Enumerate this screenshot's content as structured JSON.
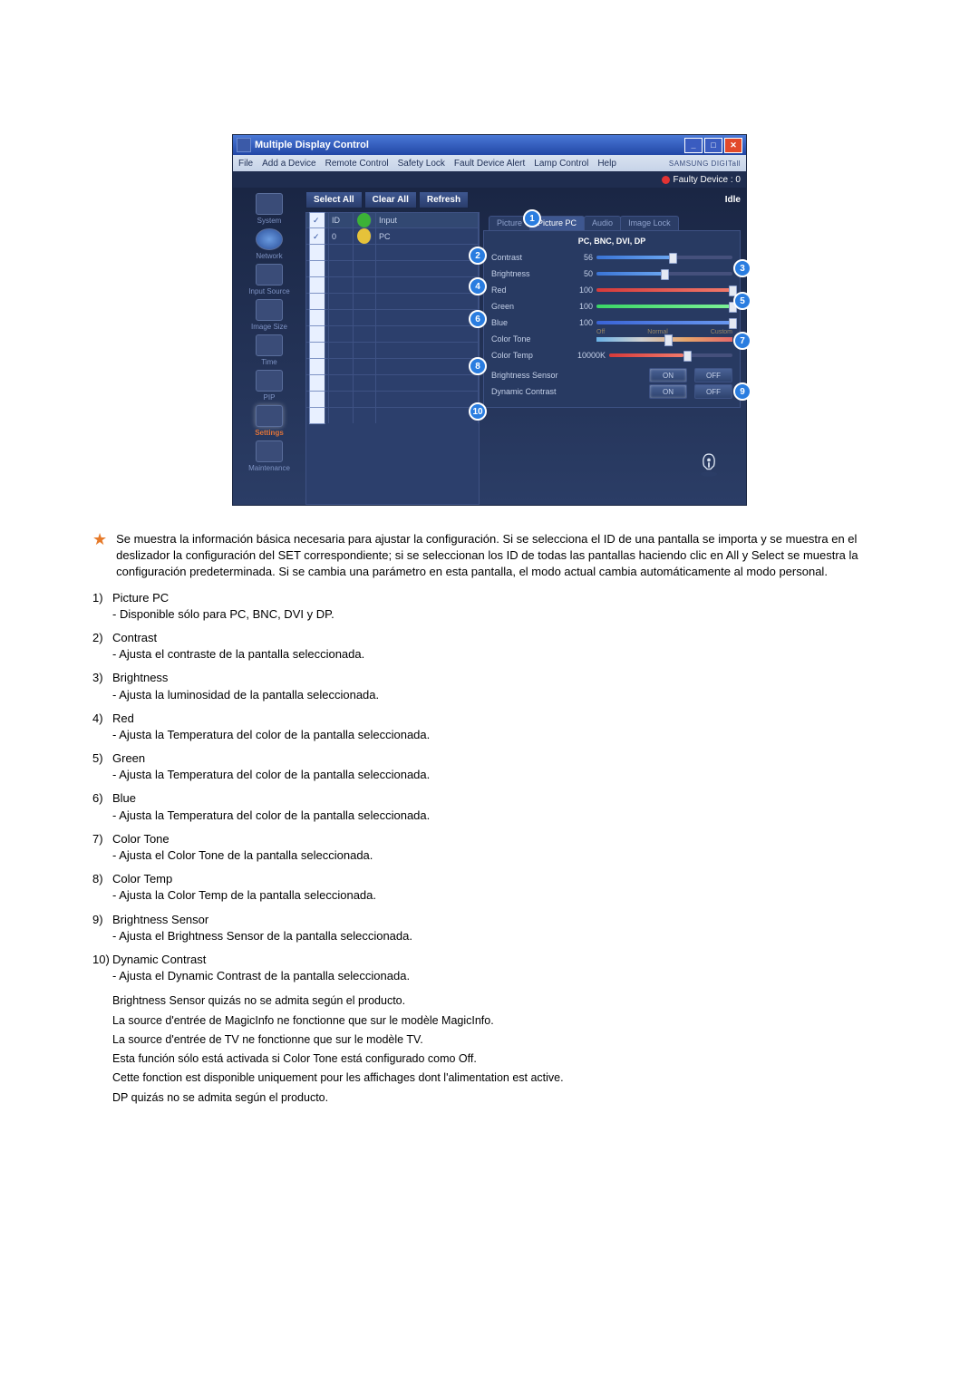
{
  "app": {
    "title": "Multiple Display Control",
    "menu": [
      "File",
      "Add a Device",
      "Remote Control",
      "Safety Lock",
      "Fault Device Alert",
      "Lamp Control",
      "Help"
    ],
    "brand": "SAMSUNG DIGITall",
    "faulty_label": "Faulty Device : 0",
    "idle": "Idle",
    "toolbar": {
      "select_all": "Select All",
      "clear_all": "Clear All",
      "refresh": "Refresh"
    },
    "sidebar": [
      {
        "label": "System"
      },
      {
        "label": "Network"
      },
      {
        "label": "Input Source"
      },
      {
        "label": "Image Size"
      },
      {
        "label": "Time"
      },
      {
        "label": "PIP"
      },
      {
        "label": "Settings",
        "selected": true
      },
      {
        "label": "Maintenance"
      }
    ],
    "grid": {
      "headers": {
        "id": "ID",
        "input": "Input"
      },
      "rows": [
        {
          "checked": true,
          "id": "0",
          "status": "y",
          "input": "PC"
        },
        {
          "checked": false,
          "id": "",
          "status": "",
          "input": ""
        },
        {
          "checked": false,
          "id": "",
          "status": "",
          "input": ""
        },
        {
          "checked": false,
          "id": "",
          "status": "",
          "input": ""
        },
        {
          "checked": false,
          "id": "",
          "status": "",
          "input": ""
        },
        {
          "checked": false,
          "id": "",
          "status": "",
          "input": ""
        },
        {
          "checked": false,
          "id": "",
          "status": "",
          "input": ""
        },
        {
          "checked": false,
          "id": "",
          "status": "",
          "input": ""
        },
        {
          "checked": false,
          "id": "",
          "status": "",
          "input": ""
        },
        {
          "checked": false,
          "id": "",
          "status": "",
          "input": ""
        },
        {
          "checked": false,
          "id": "",
          "status": "",
          "input": ""
        },
        {
          "checked": false,
          "id": "",
          "status": "",
          "input": ""
        }
      ]
    },
    "tabs": [
      "Picture",
      "Picture PC",
      "Audio",
      "Image Lock"
    ],
    "panel_title": "PC, BNC, DVI, DP",
    "sliders": {
      "contrast": {
        "label": "Contrast",
        "value": "56",
        "pct": 56,
        "fill": "c"
      },
      "brightness": {
        "label": "Brightness",
        "value": "50",
        "pct": 50,
        "fill": "c"
      },
      "red": {
        "label": "Red",
        "value": "100",
        "pct": 100,
        "fill": "r"
      },
      "green": {
        "label": "Green",
        "value": "100",
        "pct": 100,
        "fill": "g"
      },
      "blue": {
        "label": "Blue",
        "value": "100",
        "pct": 100,
        "fill": "b"
      }
    },
    "color_tone": {
      "label": "Color Tone",
      "labels": [
        "Off",
        "Normal",
        "Custom"
      ],
      "pos": 50
    },
    "color_temp": {
      "label": "Color Temp",
      "value": "10000K",
      "pos": 60
    },
    "brightness_sensor": {
      "label": "Brightness Sensor",
      "on": "ON",
      "off": "OFF"
    },
    "dynamic_contrast": {
      "label": "Dynamic Contrast",
      "on": "ON",
      "off": "OFF"
    }
  },
  "doc": {
    "intro": "Se muestra la información básica necesaria para ajustar la configuración. Si se selecciona el ID de una pantalla se importa y se muestra en el deslizador la configuración del SET correspondiente; si se seleccionan los ID de todas las pantallas haciendo clic en All y Select se muestra la configuración predeterminada. Si se cambia una parámetro en esta pantalla, el modo actual cambia automáticamente al modo personal.",
    "items": [
      {
        "n": "1)",
        "t": "Picture PC",
        "d": "- Disponible sólo para PC, BNC, DVI y DP."
      },
      {
        "n": "2)",
        "t": "Contrast",
        "d": "- Ajusta el contraste de la pantalla seleccionada."
      },
      {
        "n": "3)",
        "t": "Brightness",
        "d": "- Ajusta la luminosidad de la pantalla seleccionada."
      },
      {
        "n": "4)",
        "t": "Red",
        "d": "- Ajusta la Temperatura del color de la pantalla seleccionada."
      },
      {
        "n": "5)",
        "t": "Green",
        "d": "- Ajusta la Temperatura del color de la pantalla seleccionada."
      },
      {
        "n": "6)",
        "t": "Blue",
        "d": "- Ajusta la Temperatura del color de la pantalla seleccionada."
      },
      {
        "n": "7)",
        "t": "Color Tone",
        "d": "- Ajusta el Color Tone de la pantalla seleccionada."
      },
      {
        "n": "8)",
        "t": "Color Temp",
        "d": "- Ajusta la Color Temp de la pantalla seleccionada."
      },
      {
        "n": "9)",
        "t": "Brightness Sensor",
        "d": "- Ajusta el Brightness Sensor de la pantalla seleccionada."
      },
      {
        "n": "10)",
        "t": "Dynamic Contrast",
        "d": "- Ajusta el Dynamic Contrast de la pantalla seleccionada."
      }
    ],
    "notes": [
      "Brightness Sensor quizás no se admita según el producto.",
      "La source d'entrée de MagicInfo ne fonctionne que sur le modèle MagicInfo.",
      "La source d'entrée de TV ne fonctionne que sur le modèle TV.",
      "Esta función sólo está activada si Color Tone está configurado como Off.",
      "Cette fonction est disponible uniquement pour les affichages dont l'alimentation est active.",
      "DP quizás no se admita según el producto."
    ]
  }
}
